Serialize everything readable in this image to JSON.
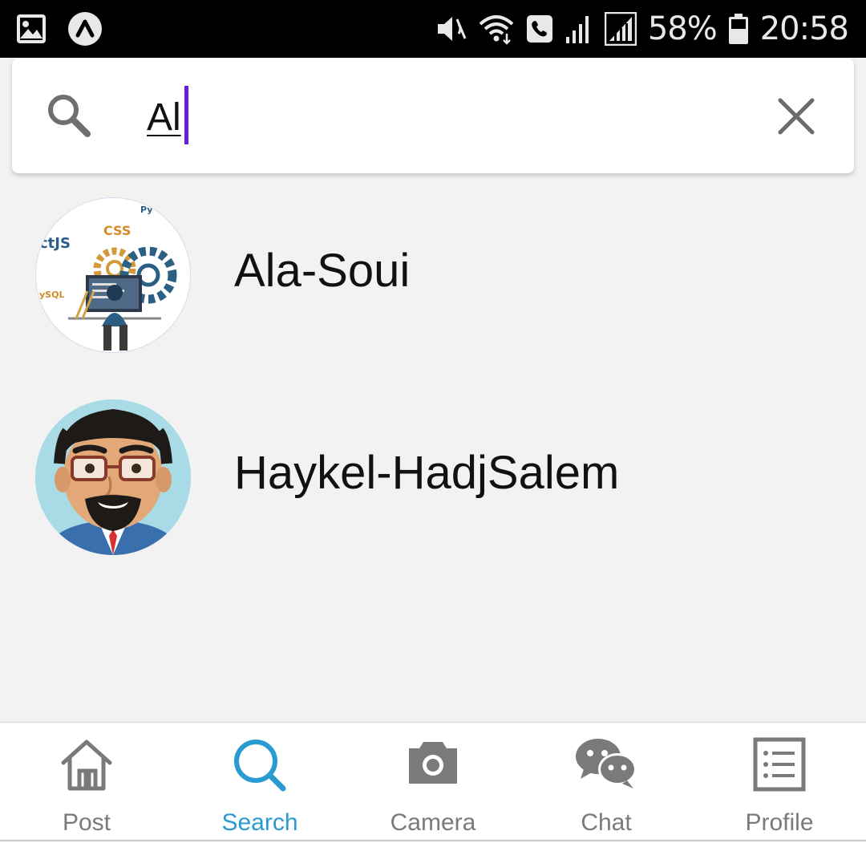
{
  "status_bar": {
    "battery": "58%",
    "time": "20:58",
    "icons_left": [
      "gallery-icon",
      "app-notification-icon"
    ],
    "icons_right": [
      "vibrate-mute-icon",
      "wifi-icon",
      "wifi-call-icon",
      "signal-1-icon",
      "signal-2-icon",
      "battery-icon"
    ]
  },
  "search": {
    "value": "Al",
    "icon": "search-icon",
    "clear_icon": "close-icon"
  },
  "results": [
    {
      "name": "Ala-Soui",
      "avatar": "avatar-dev-illustration"
    },
    {
      "name": "Haykel-HadjSalem",
      "avatar": "avatar-cartoon-man"
    }
  ],
  "avatar_1_text": {
    "css": "CSS",
    "js": "ctJS",
    "sql": "ySQL",
    "py": "Py"
  },
  "nav": [
    {
      "label": "Post",
      "icon": "home-icon"
    },
    {
      "label": "Search",
      "icon": "search-icon"
    },
    {
      "label": "Camera",
      "icon": "camera-icon"
    },
    {
      "label": "Chat",
      "icon": "chat-icon"
    },
    {
      "label": "Profile",
      "icon": "list-icon"
    }
  ],
  "colors": {
    "accent": "#2a9bd1",
    "inactive": "#7a7a7a",
    "caret": "#6a1be0",
    "background": "#f2f2f2"
  }
}
